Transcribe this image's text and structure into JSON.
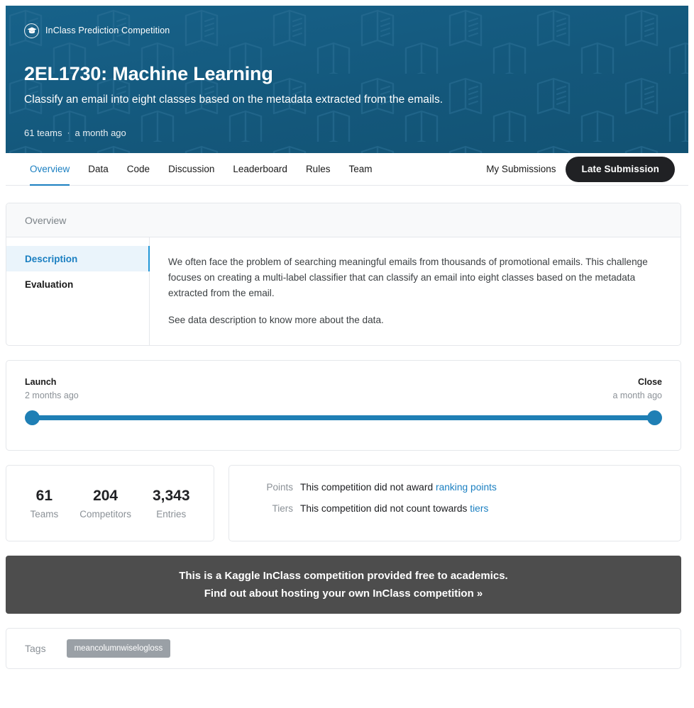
{
  "hero": {
    "badge_icon": "graduation-cap-icon",
    "badge_label": "InClass Prediction Competition",
    "title": "2EL1730: Machine Learning",
    "subtitle": "Classify an email into eight classes based on the metadata extracted from the emails.",
    "teams_count": "61 teams",
    "separator": "·",
    "updated": "a month ago",
    "bg_color": "#14587c",
    "pattern_icon": "open-book-pattern"
  },
  "nav": {
    "tabs": [
      {
        "label": "Overview",
        "active": true
      },
      {
        "label": "Data",
        "active": false
      },
      {
        "label": "Code",
        "active": false
      },
      {
        "label": "Discussion",
        "active": false
      },
      {
        "label": "Leaderboard",
        "active": false
      },
      {
        "label": "Rules",
        "active": false
      },
      {
        "label": "Team",
        "active": false
      }
    ],
    "my_submissions": "My Submissions",
    "late_submission": "Late Submission",
    "accent_color": "#1a7fc1"
  },
  "overview": {
    "header": "Overview",
    "side_items": [
      {
        "label": "Description",
        "active": true
      },
      {
        "label": "Evaluation",
        "active": false
      }
    ],
    "paragraphs": [
      "We often face the problem of searching meaningful emails from thousands of promotional emails. This challenge focuses on creating a multi-label classifier that can classify an email into eight classes based on the metadata extracted from the email.",
      "See data description to know more about the data."
    ]
  },
  "timeline": {
    "launch_label": "Launch",
    "launch_value": "2 months ago",
    "close_label": "Close",
    "close_value": "a month ago",
    "slider_color": "#1f7fb5"
  },
  "stats": [
    {
      "value": "61",
      "label": "Teams"
    },
    {
      "value": "204",
      "label": "Competitors"
    },
    {
      "value": "3,343",
      "label": "Entries"
    }
  ],
  "points": {
    "points_key": "Points",
    "points_text": "This competition did not award ",
    "points_link": "ranking points",
    "tiers_key": "Tiers",
    "tiers_text": "This competition did not count towards ",
    "tiers_link": "tiers"
  },
  "banner": {
    "line1": "This is a Kaggle InClass competition provided free to academics.",
    "line2": "Find out about hosting your own InClass competition »",
    "bg_color": "#4d4d4d"
  },
  "tags": {
    "label": "Tags",
    "items": [
      "meancolumnwiselogloss"
    ]
  }
}
